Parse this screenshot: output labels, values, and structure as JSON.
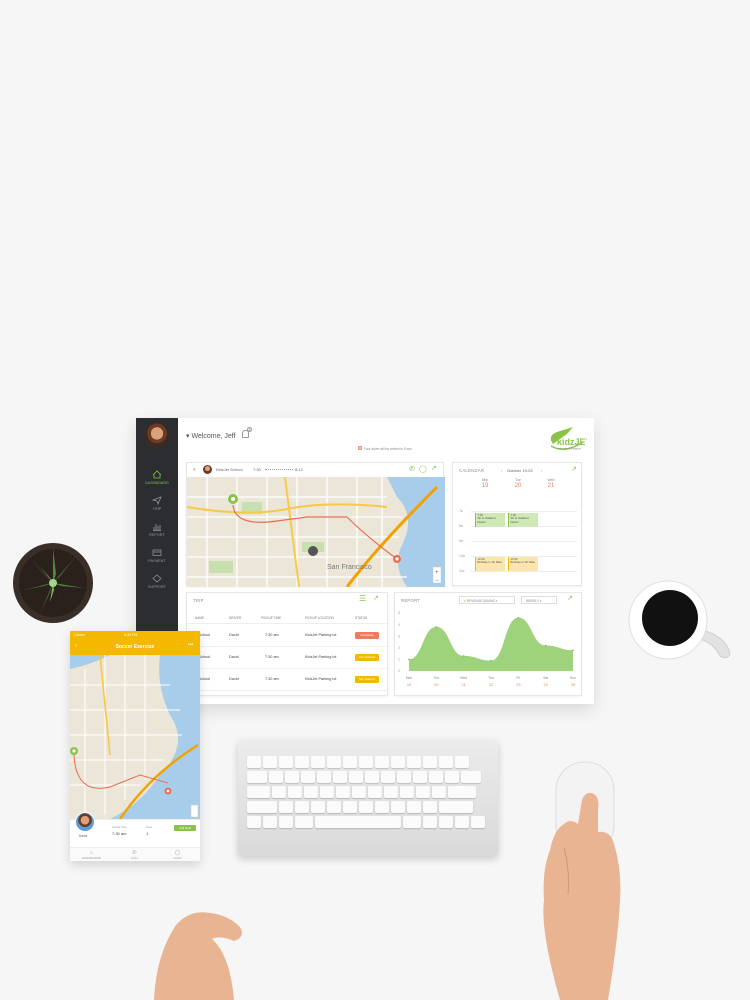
{
  "header": {
    "welcome": "Welcome, Jeff",
    "notification_count": "3",
    "notice": "Your driver will be arrived in 5 min",
    "logo_text": "kidzJET",
    "logo_tagline": "safe school transport"
  },
  "sidebar": {
    "items": [
      {
        "label": "DASHBOARD",
        "icon": "home-icon",
        "active": true
      },
      {
        "label": "TRIP",
        "icon": "paper-plane-icon"
      },
      {
        "label": "REPORT",
        "icon": "bar-chart-icon"
      },
      {
        "label": "PAYMENT",
        "icon": "card-icon"
      },
      {
        "label": "SUPPORT",
        "icon": "support-icon"
      }
    ]
  },
  "map_card": {
    "from": "KidzJet School",
    "start": "7:30",
    "end": "8:12",
    "city_label": "San Francisco"
  },
  "calendar": {
    "title": "CALENDAR",
    "month": "October 19-25",
    "days": [
      {
        "name": "Mon",
        "num": "19"
      },
      {
        "name": "Tue",
        "num": "20"
      },
      {
        "name": "Wed",
        "num": "21"
      }
    ],
    "hours": [
      "7a",
      "8a",
      "9a",
      "10a",
      "11a"
    ],
    "events": [
      {
        "time": "7:30",
        "text": "SF to Oakland Daniel",
        "col": 1,
        "row": 1,
        "color": "green"
      },
      {
        "time": "7:30",
        "text": "SF to Oakland Daniel",
        "col": 2,
        "row": 1,
        "color": "green"
      },
      {
        "time": "10:30",
        "text": "Birthday to SF Mike",
        "col": 1,
        "row": 3,
        "color": "yellow"
      },
      {
        "time": "10:30",
        "text": "Birthday to SF Mike",
        "col": 2,
        "row": 3,
        "color": "yellow"
      }
    ]
  },
  "trip": {
    "title": "TRIP",
    "columns": [
      "NAME",
      "DRIVER",
      "PICKUP TIME",
      "PICKUP LOCATION",
      "STATUS"
    ],
    "rows": [
      {
        "name": "KidzJet School",
        "driver": "David",
        "time": "7:30 am",
        "location": "KidzJet Parking lot",
        "status": "Complete",
        "color": "#f07a5c"
      },
      {
        "name": "KidzJet School",
        "driver": "David",
        "time": "7:30 am",
        "location": "KidzJet Parking lot",
        "status": "Not Started",
        "color": "#f5b800"
      },
      {
        "name": "KidzJet School",
        "driver": "David",
        "time": "7:30 am",
        "location": "KidzJet Parking lot",
        "status": "Not Started",
        "color": "#f5b800"
      }
    ]
  },
  "report": {
    "title": "REPORT",
    "filter": "REVENUE SAVING",
    "period": "WEEKLY"
  },
  "chart_data": {
    "type": "area",
    "categories": [
      "Mon",
      "Tue",
      "Wed",
      "Thu",
      "Fri",
      "Sat",
      "Sun"
    ],
    "dates": [
      "19",
      "20",
      "21",
      "22",
      "23",
      "24",
      "25"
    ],
    "values": [
      1,
      3.8,
      1.3,
      0.9,
      4.6,
      2.2,
      1.8
    ],
    "yticks": [
      "0",
      "1",
      "2",
      "3",
      "4",
      "5"
    ],
    "ylim": [
      0,
      5
    ],
    "color": "#9ed27b"
  },
  "phone": {
    "status_left": "Carrier",
    "status_time": "5:35 PM",
    "title": "Soccer Exercise",
    "driver": "David",
    "time_label": "Arrival Time",
    "time": "7:30 am",
    "seat_label": "Seat",
    "seat": "1",
    "button": "Call Now",
    "tabs": [
      "DASHBOARD",
      "CALL",
      "CHAT"
    ]
  },
  "colors": {
    "accent": "#8bc34a",
    "phone_header": "#f5b800",
    "sidebar": "#2b2d30",
    "route": "#f3a100"
  }
}
